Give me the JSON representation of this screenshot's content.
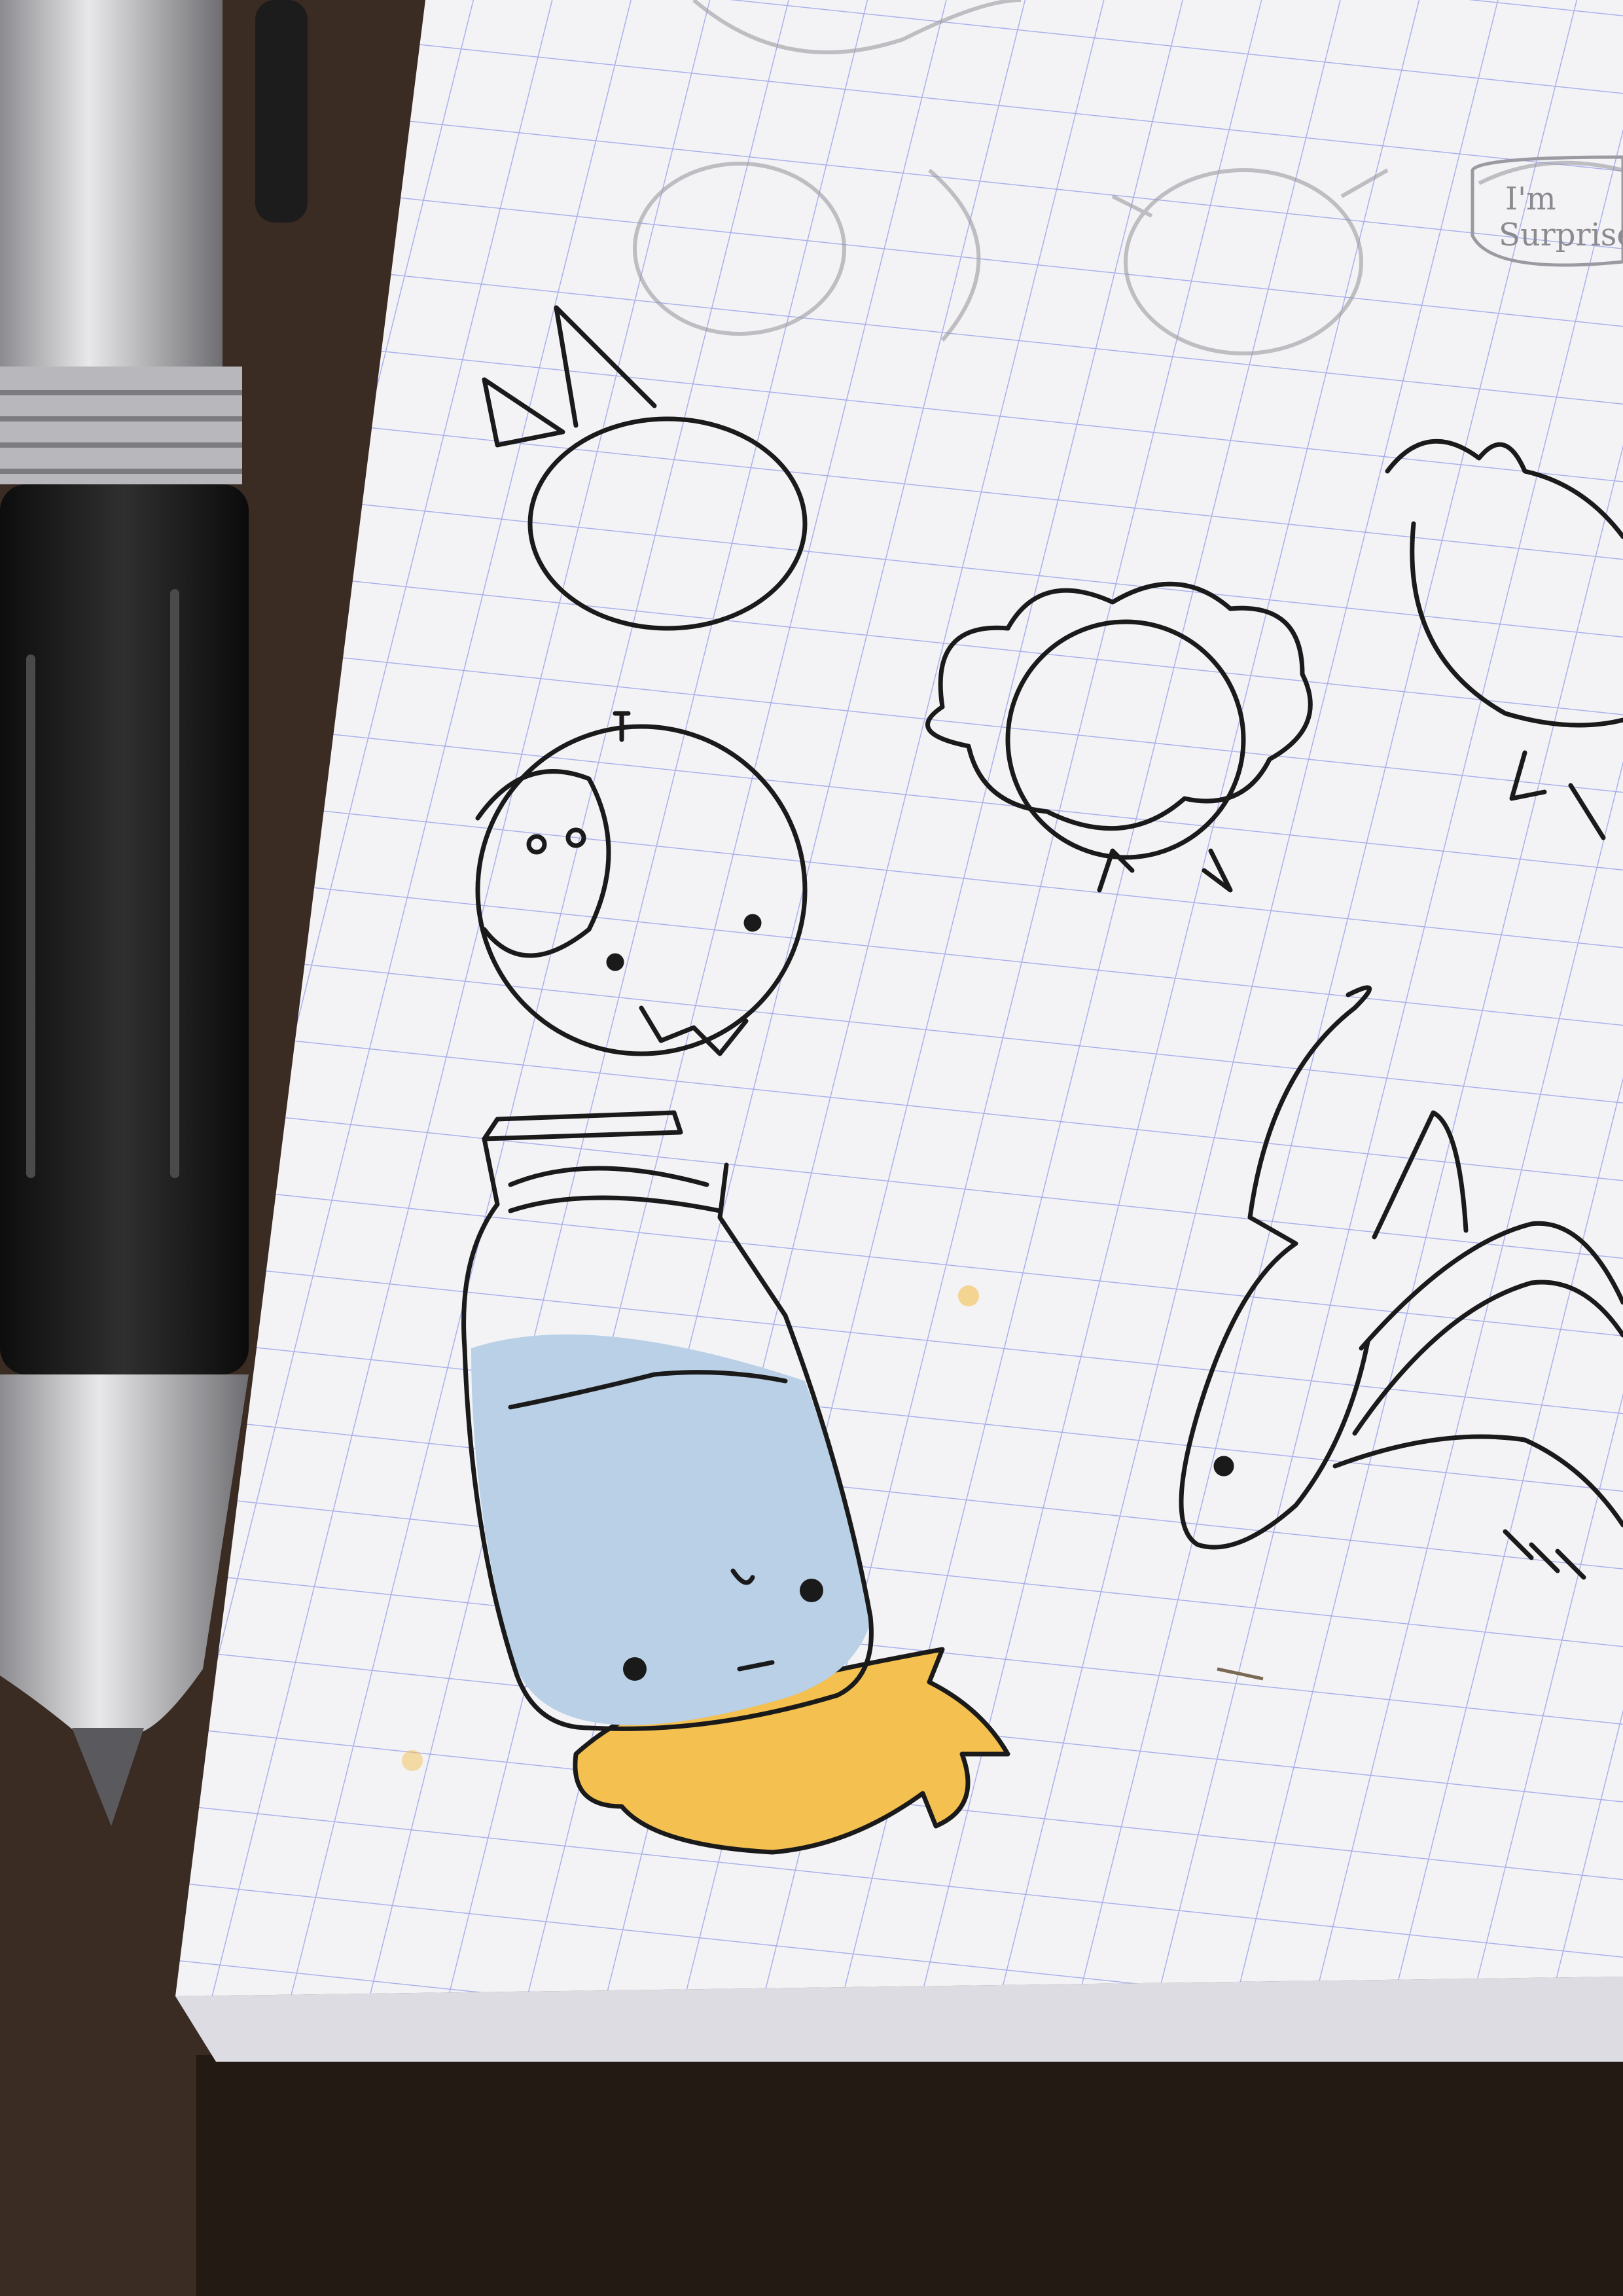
{
  "scene": {
    "description_free": true,
    "handwritten_note": {
      "line1": "I'm",
      "line2": "Surprised"
    }
  },
  "colors": {
    "desk": "#3a2c22",
    "paper": "#f3f3f6",
    "grid": "#aab0ea",
    "ink": "#1a1a1a",
    "water": "#b9d0e6",
    "spill": "#f4c04f",
    "pen_barrel": "#1e1e1e",
    "pen_clear": "#c9c9cc"
  },
  "icons": [
    "pen-icon",
    "jar-icon",
    "creature-icon"
  ]
}
